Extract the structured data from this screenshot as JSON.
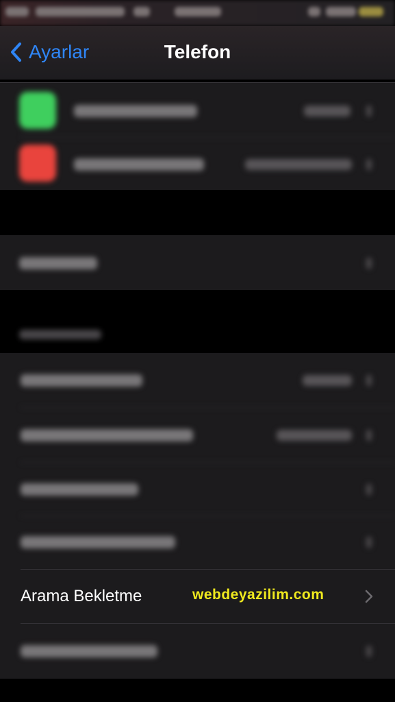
{
  "nav": {
    "back_label": "Ayarlar",
    "title": "Telefon"
  },
  "colors": {
    "accent": "#2f86f7",
    "watermark": "#f0ea1e",
    "cell_bg": "#1c1b1d",
    "green_icon": "#3fcf5e",
    "red_icon": "#e9443d"
  },
  "highlighted_row": {
    "label": "Arama Bekletme",
    "watermark": "webdeyazilim.com"
  }
}
